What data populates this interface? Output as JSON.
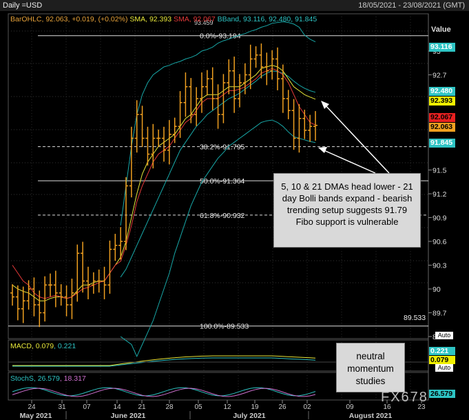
{
  "header": {
    "title": "Daily =USD",
    "date_range": "18/05/2021 - 23/08/2021 (GMT)"
  },
  "legend_main": [
    {
      "text": "BarOHLC, 92.063, +0.019, (+0.02%)",
      "color": "#e8a33a"
    },
    {
      "text": "SMA, 92.393",
      "color": "#e8e83a"
    },
    {
      "text": "SMA, 92.067",
      "color": "#e83a3a"
    },
    {
      "text": "BBand, 93.116, 92.480, 91.845",
      "color": "#2ec4c4"
    }
  ],
  "value_header": "Value",
  "auto_label": "Auto",
  "watermark": "FX678",
  "callout_main": "5, 10 & 21 DMAs head lower - 21 day Bolli bands expand - bearish trending setup suggests 91.79 Fibo support is vulnerable",
  "callout_momentum": "neutral momentum studies",
  "price_axis": {
    "ticks": [
      "93",
      "92.7",
      "91.5",
      "91.2",
      "90.9",
      "90.6",
      "90.3",
      "90",
      "89.7",
      "89.4"
    ],
    "tags": [
      {
        "text": "93.116",
        "bg": "#2ec4c4",
        "fg": "#fff"
      },
      {
        "text": "92.480",
        "bg": "#2ec4c4",
        "fg": "#fff"
      },
      {
        "text": "92.393",
        "bg": "#f0f000",
        "fg": "#000"
      },
      {
        "text": "92.067",
        "bg": "#e82020",
        "fg": "#000"
      },
      {
        "text": "92.063",
        "bg": "#f0a020",
        "fg": "#000"
      },
      {
        "text": "91.845",
        "bg": "#2ec4c4",
        "fg": "#fff"
      }
    ],
    "fibo_low_tag": "89.533"
  },
  "fibo": [
    {
      "label": "0.0%",
      "value": "93.194",
      "dashed": false
    },
    {
      "label": "38.2%",
      "value": "91.795",
      "dashed": true
    },
    {
      "label": "50.0%",
      "value": "91.364",
      "dashed": false
    },
    {
      "label": "61.8%",
      "value": "90.932",
      "dashed": true
    },
    {
      "label": "100.0%",
      "value": "89.533",
      "dashed": false
    }
  ],
  "partial_top_label": "93.459",
  "macd": {
    "legend_name": "MACD",
    "v1": "0.079",
    "v2": "0.221",
    "tags": [
      {
        "text": "0.221",
        "bg": "#2ec4c4",
        "fg": "#fff"
      },
      {
        "text": "0.079",
        "bg": "#f0f000",
        "fg": "#000"
      }
    ]
  },
  "stoch": {
    "legend_name": "StochS",
    "v1": "26.579",
    "v2": "18.317",
    "tag": {
      "text": "26.579",
      "bg": "#2ec4c4",
      "fg": "#000"
    }
  },
  "x_axis": {
    "days": [
      "24",
      "31",
      "07",
      "14",
      "21",
      "28",
      "05",
      "12",
      "19",
      "26",
      "02",
      "09",
      "16",
      "23"
    ],
    "months": [
      "May 2021",
      "June 2021",
      "July 2021",
      "August 2021"
    ]
  },
  "chart_data": {
    "type": "ohlc",
    "title": "Daily =USD",
    "ylim": [
      89.4,
      93.4
    ],
    "x": [
      "2021-05-18",
      "2021-05-19",
      "2021-05-20",
      "2021-05-21",
      "2021-05-24",
      "2021-05-25",
      "2021-05-26",
      "2021-05-27",
      "2021-05-28",
      "2021-05-31",
      "2021-06-01",
      "2021-06-02",
      "2021-06-03",
      "2021-06-04",
      "2021-06-07",
      "2021-06-08",
      "2021-06-09",
      "2021-06-10",
      "2021-06-11",
      "2021-06-14",
      "2021-06-15",
      "2021-06-16",
      "2021-06-17",
      "2021-06-18",
      "2021-06-21",
      "2021-06-22",
      "2021-06-23",
      "2021-06-24",
      "2021-06-25",
      "2021-06-28",
      "2021-06-29",
      "2021-06-30",
      "2021-07-01",
      "2021-07-02",
      "2021-07-05",
      "2021-07-06",
      "2021-07-07",
      "2021-07-08",
      "2021-07-09",
      "2021-07-12",
      "2021-07-13",
      "2021-07-14",
      "2021-07-15",
      "2021-07-16",
      "2021-07-19",
      "2021-07-20",
      "2021-07-21",
      "2021-07-22",
      "2021-07-23",
      "2021-07-26",
      "2021-07-27",
      "2021-07-28",
      "2021-07-29",
      "2021-07-30",
      "2021-08-02",
      "2021-08-03",
      "2021-08-04"
    ],
    "series": [
      {
        "name": "BarOHLC",
        "close": [
          89.9,
          89.75,
          89.85,
          90.0,
          89.8,
          89.7,
          90.05,
          90.05,
          89.95,
          89.9,
          89.8,
          89.95,
          90.45,
          90.1,
          90.05,
          90.1,
          90.1,
          90.05,
          90.5,
          90.55,
          90.6,
          91.3,
          91.9,
          92.2,
          91.9,
          91.7,
          91.9,
          91.9,
          91.75,
          91.95,
          92.05,
          92.35,
          92.55,
          92.2,
          92.4,
          92.55,
          92.65,
          92.4,
          92.2,
          92.6,
          92.75,
          92.4,
          92.6,
          92.7,
          92.9,
          92.95,
          92.8,
          92.75,
          92.9,
          92.65,
          92.4,
          92.25,
          91.9,
          92.15,
          92.0,
          92.05,
          92.063
        ]
      },
      {
        "name": "SMA",
        "close": [
          90.05,
          90.0,
          89.97,
          89.95,
          89.9,
          89.85,
          89.85,
          89.88,
          89.9,
          89.9,
          89.88,
          89.9,
          89.98,
          90.05,
          90.05,
          90.08,
          90.1,
          90.1,
          90.2,
          90.3,
          90.4,
          90.6,
          90.9,
          91.2,
          91.45,
          91.6,
          91.7,
          91.8,
          91.85,
          91.9,
          91.95,
          92.05,
          92.15,
          92.2,
          92.3,
          92.4,
          92.45,
          92.45,
          92.45,
          92.5,
          92.55,
          92.55,
          92.55,
          92.6,
          92.65,
          92.7,
          92.78,
          92.8,
          92.82,
          92.8,
          92.75,
          92.65,
          92.55,
          92.5,
          92.45,
          92.42,
          92.393
        ]
      },
      {
        "name": "SMA",
        "close": [
          90.3,
          90.2,
          90.1,
          90.05,
          89.95,
          89.9,
          89.88,
          89.9,
          89.92,
          89.9,
          89.88,
          89.9,
          89.95,
          90.0,
          90.02,
          90.05,
          90.08,
          90.1,
          90.2,
          90.3,
          90.35,
          90.55,
          90.8,
          91.1,
          91.3,
          91.45,
          91.6,
          91.7,
          91.75,
          91.8,
          91.9,
          92.0,
          92.1,
          92.15,
          92.25,
          92.35,
          92.4,
          92.4,
          92.4,
          92.45,
          92.5,
          92.5,
          92.52,
          92.55,
          92.6,
          92.65,
          92.72,
          92.75,
          92.78,
          92.75,
          92.7,
          92.6,
          92.45,
          92.3,
          92.2,
          92.1,
          92.067
        ]
      },
      {
        "name": "BBand",
        "close": [
          null,
          null,
          null,
          null,
          null,
          null,
          null,
          null,
          null,
          null,
          null,
          null,
          null,
          null,
          null,
          null,
          null,
          null,
          null,
          null,
          90.8,
          91.3,
          91.8,
          92.2,
          92.45,
          92.6,
          92.7,
          92.75,
          92.8,
          92.82,
          92.85,
          92.87,
          92.9,
          92.92,
          92.95,
          93.0,
          93.02,
          93.05,
          93.1,
          93.13,
          93.15,
          93.18,
          93.2,
          93.22,
          93.25,
          93.27,
          93.3,
          93.32,
          93.35,
          93.36,
          93.37,
          93.36,
          93.34,
          93.3,
          93.2,
          93.15,
          93.116
        ],
        "band": "upper"
      },
      {
        "name": "BBand",
        "close": [
          null,
          null,
          null,
          null,
          null,
          null,
          null,
          null,
          null,
          null,
          null,
          null,
          null,
          null,
          null,
          null,
          null,
          null,
          null,
          null,
          90.15,
          90.25,
          90.4,
          90.55,
          90.7,
          90.85,
          91.0,
          91.15,
          91.3,
          91.45,
          91.6,
          91.75,
          91.85,
          91.95,
          92.05,
          92.12,
          92.2,
          92.25,
          92.3,
          92.35,
          92.4,
          92.43,
          92.47,
          92.52,
          92.57,
          92.62,
          92.68,
          92.72,
          92.75,
          92.74,
          92.72,
          92.68,
          92.62,
          92.57,
          92.53,
          92.5,
          92.48
        ],
        "band": "middle"
      },
      {
        "name": "BBand",
        "close": [
          null,
          null,
          null,
          null,
          null,
          null,
          null,
          null,
          null,
          null,
          null,
          null,
          null,
          null,
          null,
          null,
          null,
          null,
          null,
          null,
          89.4,
          89.35,
          89.3,
          89.15,
          89.3,
          89.45,
          89.6,
          89.8,
          90.0,
          90.2,
          90.45,
          90.65,
          90.85,
          91.05,
          91.2,
          91.35,
          91.45,
          91.55,
          91.65,
          91.72,
          91.8,
          91.85,
          91.9,
          91.95,
          92.0,
          92.05,
          92.1,
          92.12,
          92.13,
          92.1,
          92.05,
          91.98,
          91.92,
          91.9,
          91.88,
          91.86,
          91.845
        ],
        "band": "lower"
      }
    ]
  }
}
